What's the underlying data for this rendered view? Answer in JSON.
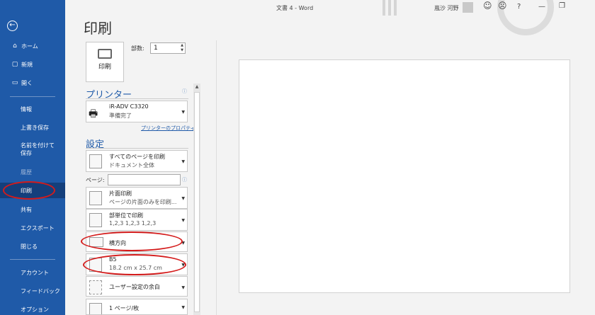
{
  "titlebar": {
    "doc_title": "文書 4 - Word",
    "user": "嵐沙 河野",
    "smile": "☺",
    "frown": "☹",
    "help": "?",
    "minimize": "—",
    "restore": "❐"
  },
  "sidebar": {
    "back": "←",
    "home": {
      "icon": "⌂",
      "label": "ホーム"
    },
    "new": {
      "icon": "▢",
      "label": "新規"
    },
    "open": {
      "icon": "▭",
      "label": "開く"
    },
    "items": [
      "情報",
      "上書き保存",
      "名前を付けて保存",
      "履歴",
      "印刷",
      "共有",
      "エクスポート",
      "閉じる",
      "アカウント",
      "フィードバック",
      "オプション"
    ]
  },
  "print": {
    "title": "印刷",
    "button_label": "印刷",
    "copies_label": "部数:",
    "copies_value": "1",
    "printer_heading": "プリンター",
    "printer_name": "iR-ADV C3320",
    "printer_status": "準備完了",
    "printer_props": "プリンターのプロパティ",
    "settings_heading": "設定",
    "pages_label": "ページ:",
    "info_mark": "ⓘ",
    "settings": [
      {
        "line1": "すべてのページを印刷",
        "line2": "ドキュメント全体"
      },
      {
        "line1": "片面印刷",
        "line2": "ページの片面のみを印刷..."
      },
      {
        "line1": "部単位で印刷",
        "line2": "1,2,3    1,2,3    1,2,3"
      },
      {
        "line1": "横方向",
        "line2": ""
      },
      {
        "line1": "B5",
        "line2": "18.2 cm x 25.7 cm"
      },
      {
        "line1": "ユーザー設定の余白",
        "line2": ""
      },
      {
        "line1": "1 ページ/枚",
        "line2": ""
      }
    ]
  },
  "annotations": {
    "circle_color": "#d41b1b"
  }
}
